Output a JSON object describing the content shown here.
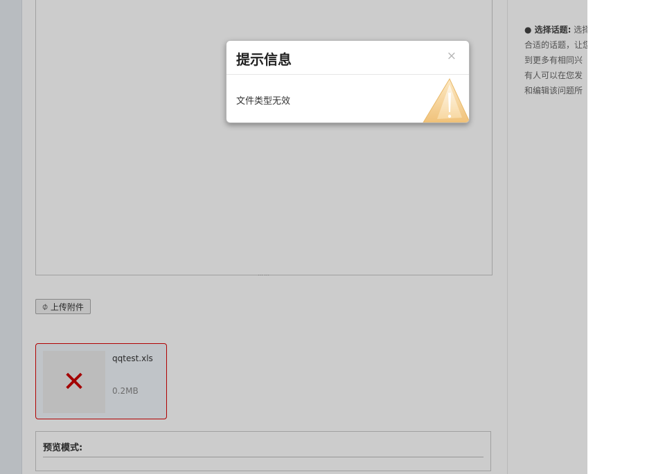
{
  "editor": {
    "resize_glyph": "⋯⋯"
  },
  "toolbar": {
    "upload_label": "上传附件",
    "upload_icon": "paperclip-icon"
  },
  "attachment": {
    "file_name": "qqtest.xls",
    "file_size": "0.2MB",
    "status_icon": "error-x-icon",
    "status_glyph": "✕",
    "status_color": "#c00000"
  },
  "preview": {
    "label": "预览模式:"
  },
  "sidebar": {
    "help_bold": "● 选择话题:",
    "help_lines": [
      "选择",
      "合适的话题，让您",
      "到更多有相同兴",
      "有人可以在您发",
      "和编辑该问题所"
    ]
  },
  "modal": {
    "title": "提示信息",
    "close_glyph": "×",
    "message": "文件类型无效",
    "icon": "warning-triangle-icon"
  }
}
